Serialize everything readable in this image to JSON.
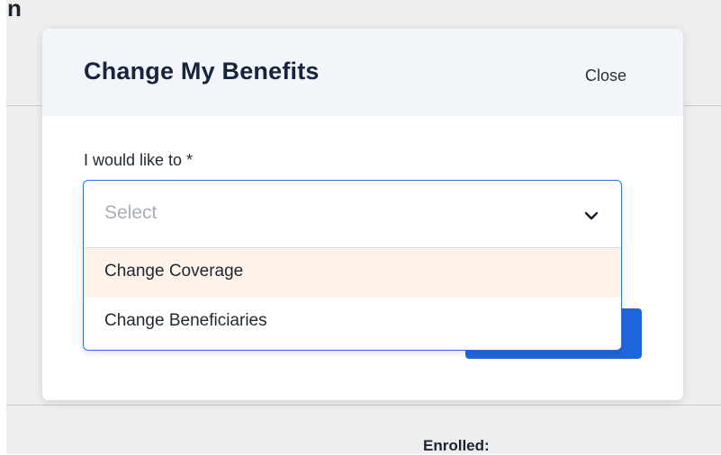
{
  "background": {
    "heading_fragment": "n",
    "enrolled_label": "Enrolled:"
  },
  "modal": {
    "title": "Change My Benefits",
    "close_label": "Close",
    "field_label": "I would like to *",
    "select": {
      "placeholder": "Select",
      "options": [
        "Change Coverage",
        "Change Beneficiaries"
      ],
      "highlighted_option": "Change Coverage"
    }
  },
  "colors": {
    "primary_button": "#1f66dd",
    "select_border": "#2f6fe0",
    "header_background": "#f2f5fa",
    "highlighted_option_background": "#fdf3ea",
    "title_text": "#17243b"
  },
  "icons": {
    "select_indicator": "chevron-down-icon"
  }
}
